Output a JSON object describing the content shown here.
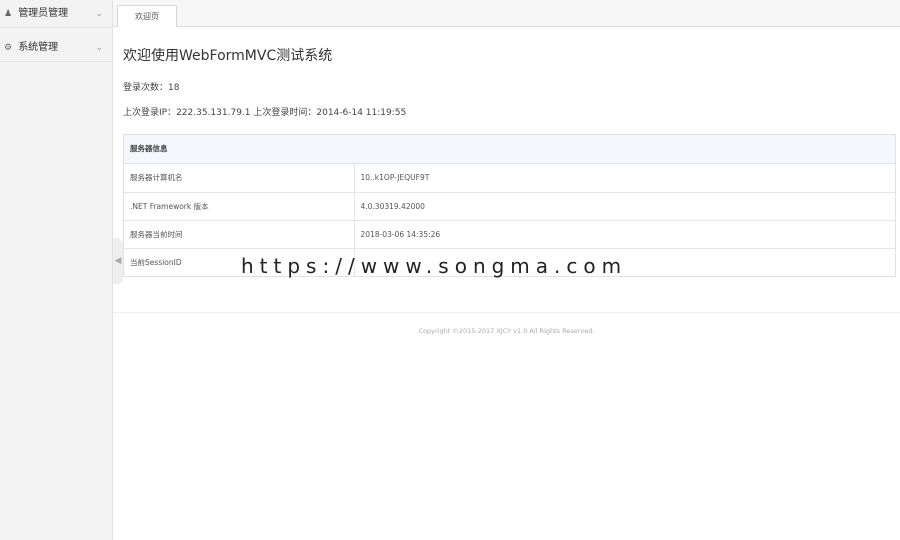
{
  "sidebar": {
    "items": [
      {
        "label": "管理员管理",
        "icon": "user-icon"
      },
      {
        "label": "系统管理",
        "icon": "gear-icon"
      }
    ]
  },
  "tabs": [
    {
      "label": "欢迎页"
    }
  ],
  "main": {
    "title": "欢迎使用WebFormMVC测试系统",
    "login_count": "登录次数：18",
    "last_login": "上次登录IP：222.35.131.79.1 上次登录时间：2014-6-14 11:19:55",
    "server_panel": {
      "header": "服务器信息",
      "rows": [
        {
          "key": "服务器计算机名",
          "value": "10..k1OP-JEQUF9T"
        },
        {
          "key": ".NET Framework 版本",
          "value": "4.0.30319.42000"
        },
        {
          "key": "服务器当前时间",
          "value": "2018-03-06 14:35:26"
        },
        {
          "key": "当前SessionID",
          "value": ""
        }
      ]
    }
  },
  "watermark": "https://www.songma.com",
  "footer": "Copyright ©2015-2017 XJCY v1.0 All Rights Reserved."
}
